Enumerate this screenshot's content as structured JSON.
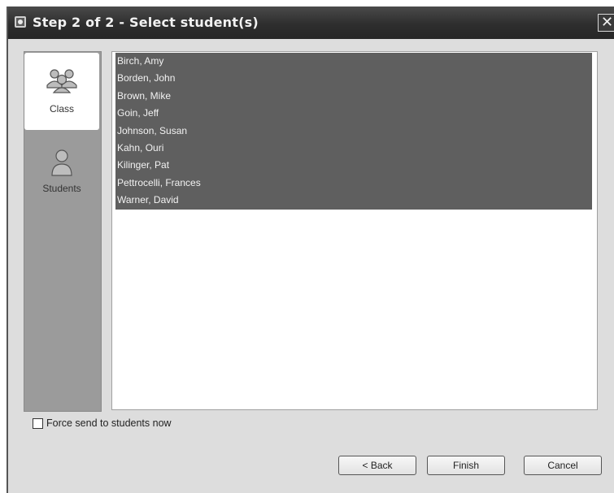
{
  "window": {
    "title": "Step 2 of 2 - Select student(s)",
    "close_glyph": "✕"
  },
  "nav": {
    "items": [
      {
        "label": "Class",
        "icon": "group-icon",
        "active": true
      },
      {
        "label": "Students",
        "icon": "person-icon",
        "active": false
      }
    ]
  },
  "students": [
    "Birch, Amy",
    "Borden, John",
    "Brown, Mike",
    "Goin, Jeff",
    "Johnson, Susan",
    "Kahn, Ouri",
    "Kilinger, Pat",
    "Pettrocelli, Frances",
    "Warner, David"
  ],
  "force_send": {
    "label": "Force send to students now",
    "checked": false
  },
  "buttons": {
    "back": "< Back",
    "finish": "Finish",
    "cancel": "Cancel"
  },
  "colors": {
    "selection": "#5f5f5f",
    "nav_bg": "#9b9b9b",
    "title_bar": "#2e2e2e"
  }
}
